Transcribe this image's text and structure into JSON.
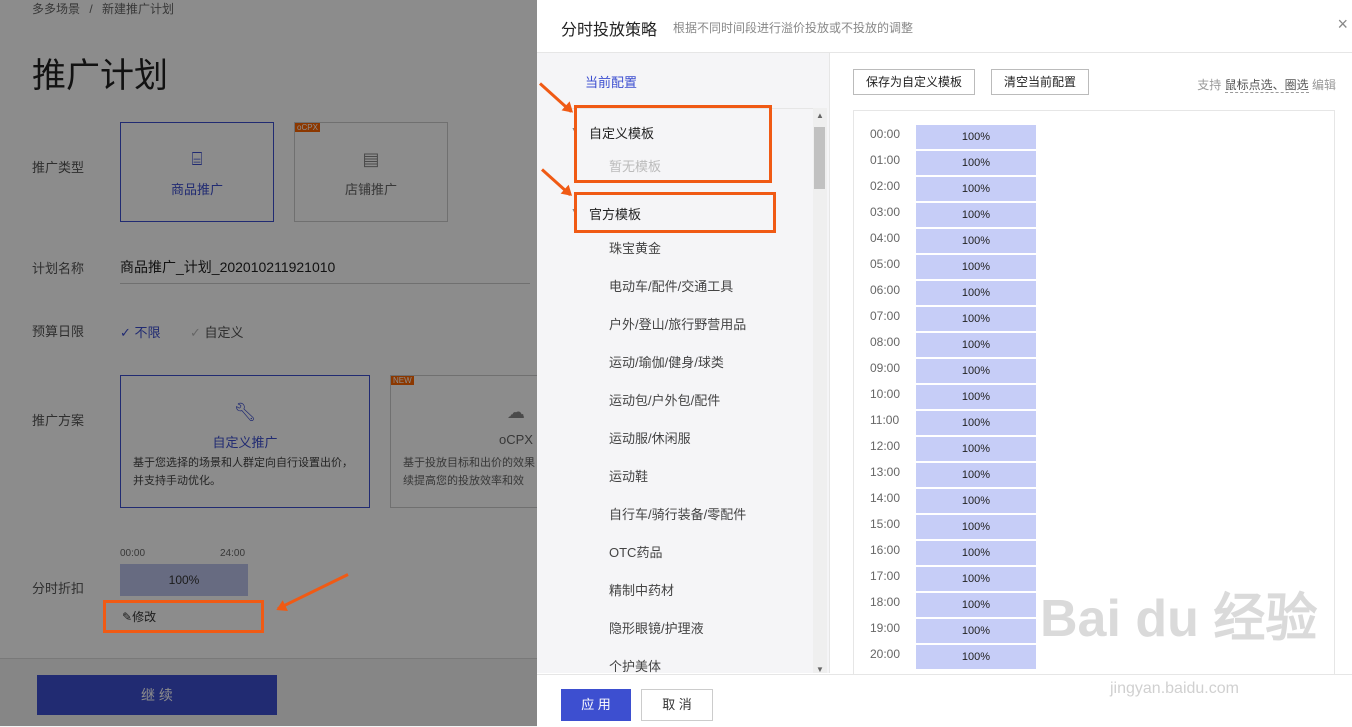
{
  "breadcrumb": [
    "多多场景",
    "/",
    "新建推广计划"
  ],
  "page_title": "推广计划",
  "form": {
    "type_label": "推广类型",
    "type_options": [
      {
        "label": "商品推广",
        "tag": ""
      },
      {
        "label": "店铺推广",
        "tag": "oCPX"
      }
    ],
    "name_label": "计划名称",
    "name_value": "商品推广_计划_202010211921010",
    "budget_label": "预算日限",
    "budget_options": [
      "不限",
      "自定义"
    ],
    "plan_label": "推广方案",
    "plan_options": [
      {
        "title": "自定义推广",
        "desc": "基于您选择的场景和人群定向自行设置出价，并支持手动优化。",
        "tag": ""
      },
      {
        "title": "oCPX",
        "desc": "基于投放目标和出价的效果续提高您的投放效率和效",
        "tag": "NEW"
      }
    ],
    "discount_label": "分时折扣",
    "mini_start": "00:00",
    "mini_end": "24:00",
    "mini_value": "100%",
    "edit_label": "修改",
    "continue_label": "继 续"
  },
  "drawer": {
    "title": "分时投放策略",
    "subtitle": "根据不同时间段进行溢价投放或不投放的调整",
    "close": "×",
    "current_config": "当前配置",
    "custom_group": "自定义模板",
    "custom_empty": "暂无模板",
    "official_group": "官方模板",
    "templates": [
      "珠宝黄金",
      "电动车/配件/交通工具",
      "户外/登山/旅行野营用品",
      "运动/瑜伽/健身/球类",
      "运动包/户外包/配件",
      "运动服/休闲服",
      "运动鞋",
      "自行车/骑行装备/零配件",
      "OTC药品",
      "精制中药材",
      "隐形眼镜/护理液",
      "个护美体"
    ],
    "save_btn": "保存为自定义模板",
    "clear_btn": "清空当前配置",
    "hint_prefix": "支持",
    "hint_a": "鼠标点选、圈选",
    "hint_suffix": "编辑",
    "hours": [
      "00:00",
      "01:00",
      "02:00",
      "03:00",
      "04:00",
      "05:00",
      "06:00",
      "07:00",
      "08:00",
      "09:00",
      "10:00",
      "11:00",
      "12:00",
      "13:00",
      "14:00",
      "15:00",
      "16:00",
      "17:00",
      "18:00",
      "19:00",
      "20:00"
    ],
    "hour_values": [
      "100%",
      "100%",
      "100%",
      "100%",
      "100%",
      "100%",
      "100%",
      "100%",
      "100%",
      "100%",
      "100%",
      "100%",
      "100%",
      "100%",
      "100%",
      "100%",
      "100%",
      "100%",
      "100%",
      "100%",
      "100%"
    ],
    "apply": "应 用",
    "cancel": "取 消"
  },
  "watermark": {
    "main": "Bai du 经验",
    "url": "jingyan.baidu.com"
  },
  "colors": {
    "accent": "#3d4fd0",
    "highlight": "#f05a14",
    "cell": "#c6cdf7"
  }
}
